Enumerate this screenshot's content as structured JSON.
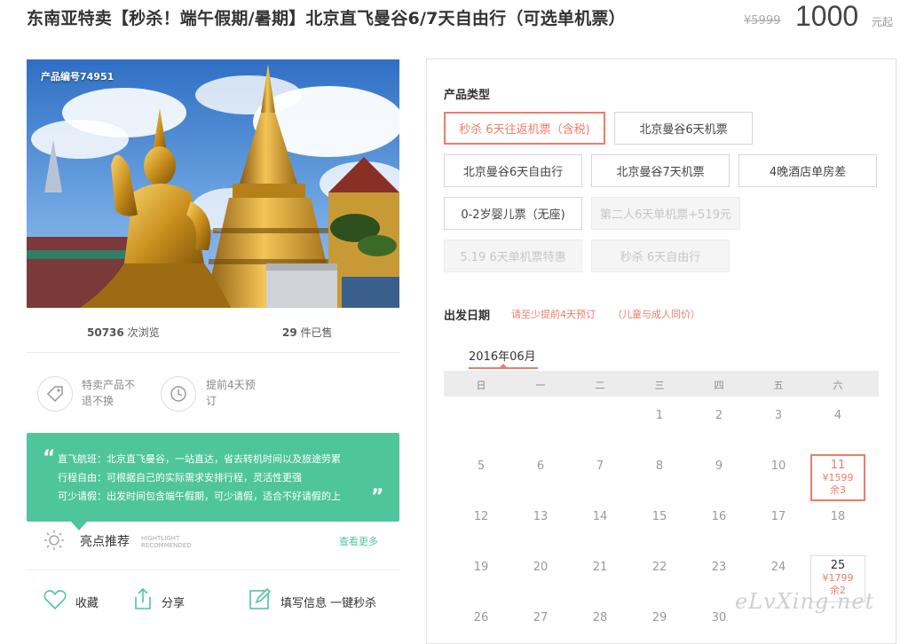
{
  "header": {
    "title": "东南亚特卖【秒杀！端午假期/暑期】北京直飞曼谷6/7天自由行（可选单机票）",
    "price_old": "¥5999",
    "price_new": "1000",
    "price_unit": "元起"
  },
  "product": {
    "id_label": "产品编号74951",
    "views_count": "50736",
    "views_label": "次浏览",
    "sold_count": "29",
    "sold_label": "件已售"
  },
  "features": [
    {
      "icon": "tag-icon",
      "line1": "特卖产品不",
      "line2": "退不换"
    },
    {
      "icon": "clock-icon",
      "line1": "提前4天预",
      "line2": "订"
    }
  ],
  "highlights_quote": {
    "lines": [
      "直飞航班：北京直飞曼谷，一站直达，省去转机时间以及旅途劳累",
      "行程自由：可根据自己的实际需求安排行程，灵活性更强",
      "可少请假：出发时间包含端午假期，可少请假，适合不好请假的上"
    ],
    "accent_color": "#4fc59c"
  },
  "highlights": {
    "title": "亮点推荐",
    "en1": "HIGHTLIGHT",
    "en2": "RECOMMENDED",
    "more": "查看更多"
  },
  "actions": {
    "favorite": "收藏",
    "share": "分享",
    "book": "填写信息 一键秒杀"
  },
  "booking": {
    "type_label": "产品类型",
    "options": [
      {
        "label": "秒杀 6天往返机票（含税)",
        "state": "selected"
      },
      {
        "label": "北京曼谷6天机票",
        "state": "normal"
      },
      {
        "label": "北京曼谷6天自由行",
        "state": "normal"
      },
      {
        "label": "北京曼谷7天机票",
        "state": "normal"
      },
      {
        "label": "4晚酒店单房差",
        "state": "normal"
      },
      {
        "label": "0-2岁婴儿票（无座)",
        "state": "normal"
      },
      {
        "label": "第二人6天单机票+519元",
        "state": "disabled"
      },
      {
        "label": "5.19 6天单机票特惠",
        "state": "disabled"
      },
      {
        "label": "秒杀 6天自由行",
        "state": "disabled"
      }
    ],
    "date_label": "出发日期",
    "note1": "请至少提前4天预订",
    "note2": "（儿童与成人同价）",
    "accent_color": "#f07b6a"
  },
  "calendar": {
    "month": "2016年06月",
    "weekdays": [
      "日",
      "一",
      "二",
      "三",
      "四",
      "五",
      "六"
    ],
    "rows": [
      [
        "",
        "",
        "",
        "1",
        "2",
        "3",
        "4"
      ],
      [
        "5",
        "6",
        "7",
        "8",
        "9",
        "10",
        "11"
      ],
      [
        "12",
        "13",
        "14",
        "15",
        "16",
        "17",
        "18"
      ],
      [
        "19",
        "20",
        "21",
        "22",
        "23",
        "24",
        "25"
      ],
      [
        "26",
        "27",
        "28",
        "29",
        "30",
        "",
        ""
      ]
    ],
    "available": [
      {
        "day": "11",
        "price": "¥1599",
        "stock": "余3",
        "state": "selected"
      },
      {
        "day": "25",
        "price": "¥1799",
        "stock": "余2",
        "state": "available"
      }
    ]
  },
  "watermark": "eLvXing.net"
}
